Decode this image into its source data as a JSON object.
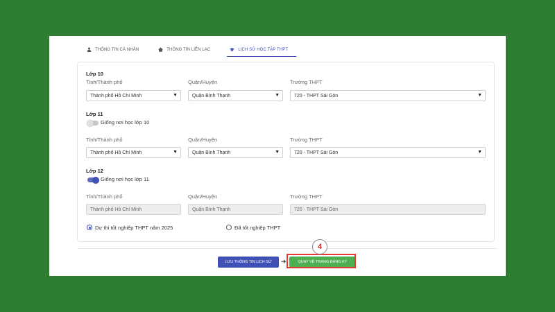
{
  "tabs": [
    {
      "label": "THÔNG TIN CÁ NHÂN",
      "icon": "person-icon"
    },
    {
      "label": "THÔNG TIN LIÊN LẠC",
      "icon": "home-icon"
    },
    {
      "label": "LỊCH SỬ HỌC TẬP THPT",
      "icon": "graduation-cap-icon",
      "active": true
    }
  ],
  "labels": {
    "city": "Tỉnh/Thành phố",
    "district": "Quận/Huyện",
    "school": "Trường THPT"
  },
  "grade10": {
    "title": "Lớp 10",
    "city": "Thành phố Hồ Chí Minh",
    "district": "Quận Bình Thạnh",
    "school": "720 - THPT Sài Gòn"
  },
  "grade11": {
    "title": "Lớp 11",
    "toggle_label": "Giống nơi học lớp 10",
    "toggle_on": false,
    "city": "Thành phố Hồ Chí Minh",
    "district": "Quận Bình Thạnh",
    "school": "720 - THPT Sài Gòn"
  },
  "grade12": {
    "title": "Lớp 12",
    "toggle_label": "Giống nơi học lớp 11",
    "toggle_on": true,
    "city": "Thành phố Hồ Chí Minh",
    "district": "Quận Bình Thạnh",
    "school": "720 - THPT Sài Gòn"
  },
  "options": {
    "exam_2025": "Dự thi tốt nghiệp THPT năm 2025",
    "graduated": "Đã tốt nghiệp THPT",
    "selected": "exam_2025"
  },
  "buttons": {
    "save": "LƯU THÔNG TIN LỊCH SỬ",
    "back": "QUAY VỀ TRANG ĐĂNG KÝ"
  },
  "annotation": {
    "step": "4",
    "arrow": "➔"
  },
  "colors": {
    "background": "#2e7d32",
    "primary": "#3f51b5",
    "success": "#4caf50",
    "highlight": "#e53935"
  }
}
